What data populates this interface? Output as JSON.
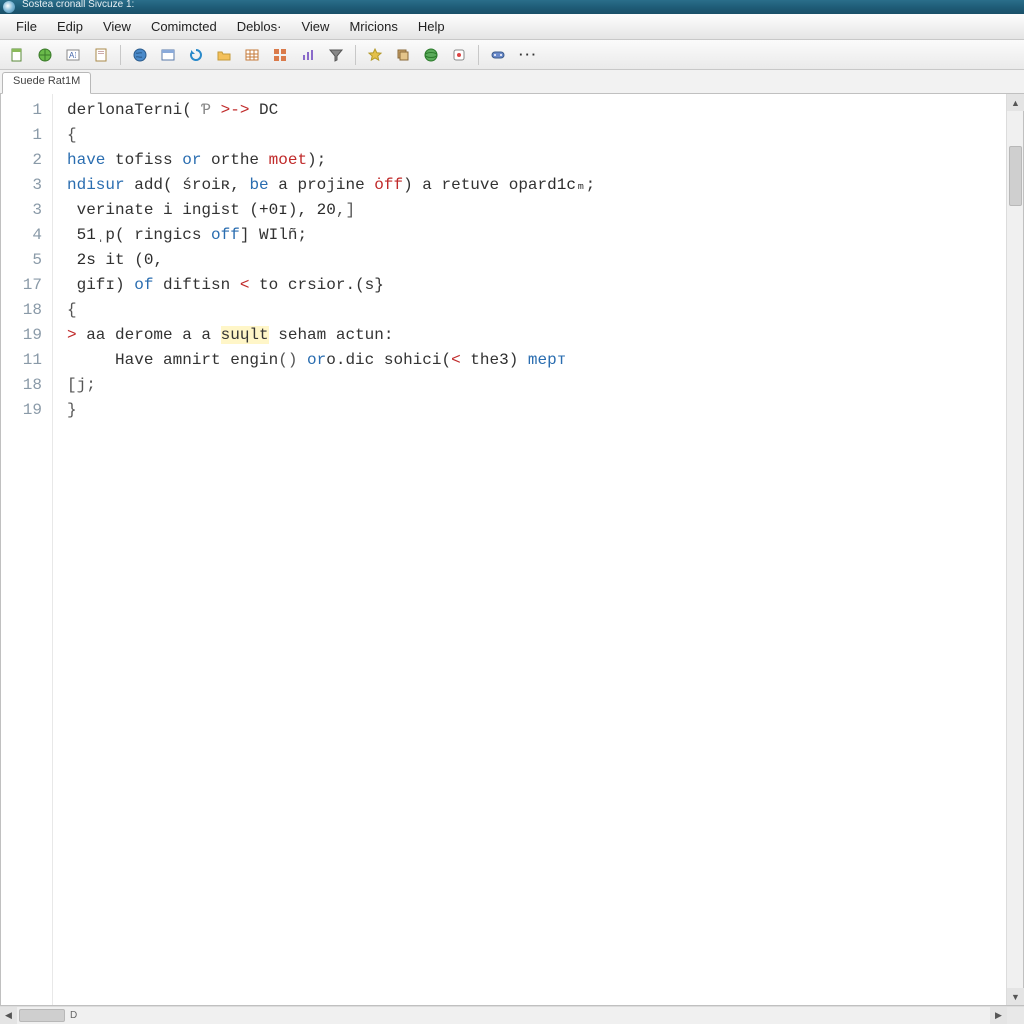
{
  "window": {
    "title": "Sostea cronall Sivcuze 1:"
  },
  "menu": {
    "items": [
      "File",
      "Edip",
      "View",
      "Comimcted",
      "Deblos·",
      "View",
      "Mricions",
      "Help"
    ]
  },
  "toolbar": {
    "icons": [
      "new-file-icon",
      "globe-icon",
      "text-frame-icon",
      "doc-icon",
      "world-icon",
      "window-icon",
      "refresh-icon",
      "folder-icon",
      "table-icon",
      "grid-icon",
      "chart-icon",
      "filter-icon",
      "star-icon",
      "stack-icon",
      "earth-icon",
      "badge-icon",
      "controller-icon"
    ],
    "overflow": "···"
  },
  "tabs": {
    "active": "Suede Rat1M"
  },
  "code": {
    "gutter": [
      "1",
      "1",
      "2",
      "3",
      "3",
      "4",
      "5",
      "17",
      "18",
      "19",
      "11",
      "18",
      "19",
      ""
    ],
    "lines": [
      [
        {
          "t": "derlonaTerni",
          "c": "fn"
        },
        {
          "t": "( "
        },
        {
          "t": "Ƥ ",
          "c": "cm"
        },
        {
          "t": ">",
          "c": "op"
        },
        {
          "t": "-> ",
          "c": "op"
        },
        {
          "t": "DC"
        }
      ],
      [
        {
          "t": "{",
          "c": "br"
        }
      ],
      [
        {
          "t": "have",
          "c": "kw"
        },
        {
          "t": " tofiss "
        },
        {
          "t": "or",
          "c": "kw"
        },
        {
          "t": " orthe "
        },
        {
          "t": "moet",
          "c": "op"
        },
        {
          "t": ");"
        }
      ],
      [
        {
          "t": "ndisur",
          "c": "kw"
        },
        {
          "t": " "
        },
        {
          "t": "add",
          "c": "fn"
        },
        {
          "t": "( śroiʀ, "
        },
        {
          "t": "be",
          "c": "kw"
        },
        {
          "t": " a projine "
        },
        {
          "t": "ȯff",
          "c": "op"
        },
        {
          "t": ") a retuve opar"
        },
        {
          "t": "d1c",
          "c": "num"
        },
        {
          "t": "ₘ;"
        }
      ],
      [
        {
          "t": " verinate i ingist ("
        },
        {
          "t": "+0ɪ",
          "c": "num"
        },
        {
          "t": "), "
        },
        {
          "t": "20",
          "c": "num"
        },
        {
          "t": ",",
          "c": "br"
        },
        {
          "t": "]",
          "c": "br"
        }
      ],
      [
        {
          "t": " 51",
          "c": "num"
        },
        {
          "t": "ˌp( ringics "
        },
        {
          "t": "off",
          "c": "kw"
        },
        {
          "t": "] "
        },
        {
          "t": "WIlñ",
          "c": "fn"
        },
        {
          "t": ";"
        }
      ],
      [
        {
          "t": " 2s",
          "c": "num"
        },
        {
          "t": " it ("
        },
        {
          "t": "0",
          "c": "num"
        },
        {
          "t": ","
        }
      ],
      [
        {
          "t": " gifɪ) "
        },
        {
          "t": "of",
          "c": "kw"
        },
        {
          "t": " diftisn "
        },
        {
          "t": "<",
          "c": "op"
        },
        {
          "t": " to crsior.(s}"
        }
      ],
      [
        {
          "t": "{",
          "c": "br"
        }
      ],
      [
        {
          "t": "> ",
          "c": "op"
        },
        {
          "t": "aa derome a a "
        },
        {
          "t": "suɥlt",
          "c": "hl"
        },
        {
          "t": " seham "
        },
        {
          "t": "actun",
          "c": "fn"
        },
        {
          "t": ":"
        }
      ],
      [
        {
          "t": "     Have amnirt engin"
        },
        {
          "t": "()",
          "c": "br"
        },
        {
          "t": " "
        },
        {
          "t": "or",
          "c": "kw"
        },
        {
          "t": "o.dic sohici("
        },
        {
          "t": "<",
          "c": "op"
        },
        {
          "t": " the"
        },
        {
          "t": "3",
          "c": "num"
        },
        {
          "t": ") "
        },
        {
          "t": "mepᴛ",
          "c": "kw"
        }
      ],
      [
        {
          "t": "[j;",
          "c": "br"
        }
      ],
      [
        {
          "t": ""
        }
      ],
      [
        {
          "t": "}",
          "c": "br"
        }
      ]
    ]
  },
  "hscroll": {
    "mark": "D"
  }
}
